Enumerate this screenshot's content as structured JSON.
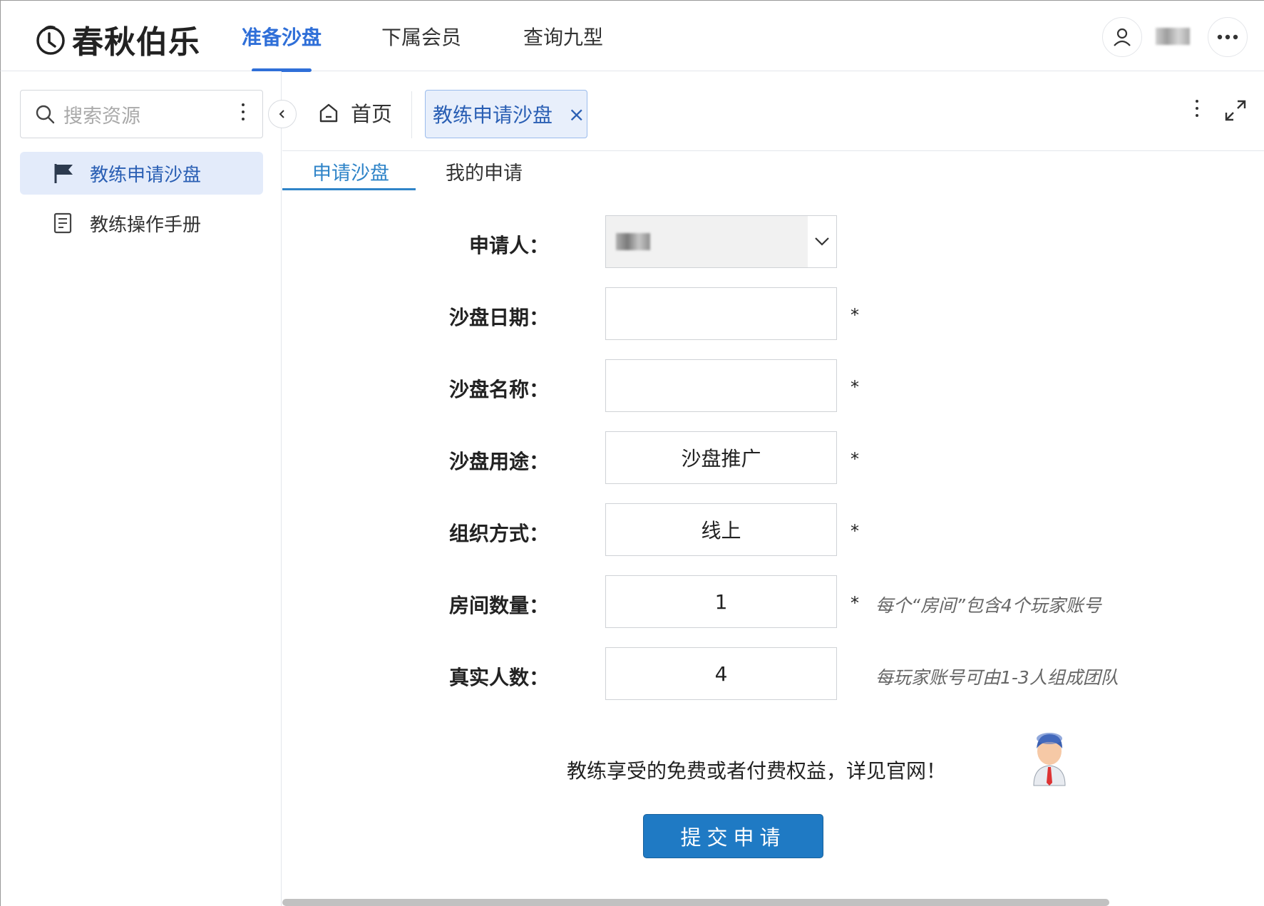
{
  "header": {
    "logo_text": "春秋伯乐",
    "nav": [
      "准备沙盘",
      "下属会员",
      "查询九型"
    ],
    "active_nav": 0
  },
  "sidebar": {
    "search_placeholder": "搜索资源",
    "items": [
      {
        "label": "教练申请沙盘",
        "icon": "flag-icon",
        "active": true
      },
      {
        "label": "教练操作手册",
        "icon": "document-icon",
        "active": false
      }
    ]
  },
  "tabs": {
    "home_label": "首页",
    "open_tab_label": "教练申请沙盘",
    "close_symbol": "×"
  },
  "subtabs": [
    "申请沙盘",
    "我的申请"
  ],
  "form": {
    "applicant_label": "申请人：",
    "date_label": "沙盘日期：",
    "date_value": "",
    "name_label": "沙盘名称：",
    "name_value": "",
    "purpose_label": "沙盘用途：",
    "purpose_value": "沙盘推广",
    "org_label": "组织方式：",
    "org_value": "线上",
    "rooms_label": "房间数量：",
    "rooms_value": "1",
    "rooms_hint": "每个“房间”包含4个玩家账号",
    "people_label": "真实人数：",
    "people_value": "4",
    "people_hint": "每玩家账号可由1-3人组成团队",
    "required_mark": "*"
  },
  "notice": "教练享受的免费或者付费权益，详见官网！",
  "submit_label": "提交申请",
  "colors": {
    "accent": "#2f6fd8",
    "button": "#1f7ac4",
    "active_bg": "#e3ebfa"
  }
}
